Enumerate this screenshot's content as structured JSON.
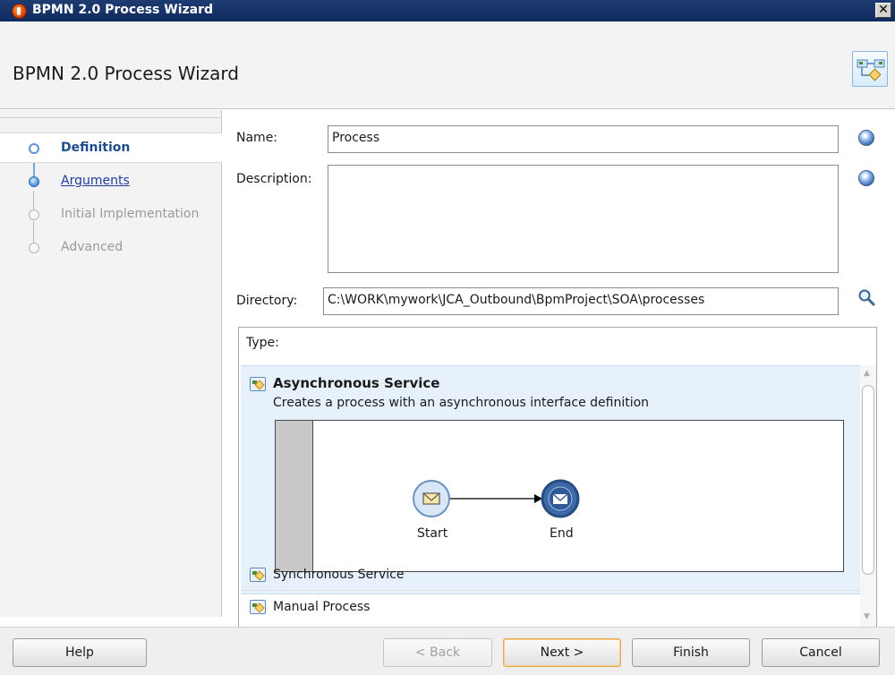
{
  "window": {
    "title": "BPMN 2.0 Process Wizard",
    "close_glyph": "✕"
  },
  "header": {
    "heading": "BPMN 2.0 Process Wizard",
    "icon": "process-wizard-icon"
  },
  "nav": {
    "items": [
      {
        "label": "Definition",
        "state": "active"
      },
      {
        "label": "Arguments",
        "state": "link"
      },
      {
        "label": "Initial Implementation",
        "state": "disabled"
      },
      {
        "label": "Advanced",
        "state": "disabled"
      }
    ]
  },
  "form": {
    "name_label": "Name:",
    "name_value": "Process",
    "description_label": "Description:",
    "description_value": "",
    "directory_label": "Directory:",
    "directory_value": "C:\\WORK\\mywork\\JCA_Outbound\\BpmProject\\SOA\\processes"
  },
  "type": {
    "label": "Type:",
    "options": [
      {
        "title": "Asynchronous Service",
        "description": "Creates a process with an asynchronous interface definition",
        "selected": true,
        "diagram": {
          "start_label": "Start",
          "end_label": "End"
        }
      },
      {
        "title": "Synchronous Service"
      },
      {
        "title": "Manual Process"
      }
    ]
  },
  "footer": {
    "help": "Help",
    "back": "< Back",
    "next": "Next >",
    "finish": "Finish",
    "cancel": "Cancel"
  },
  "colors": {
    "titlebar": "#1f3c72",
    "nav_active": "#1f4d8c",
    "default_button_border": "#e7a64a",
    "selection": "#e6f1fb"
  }
}
